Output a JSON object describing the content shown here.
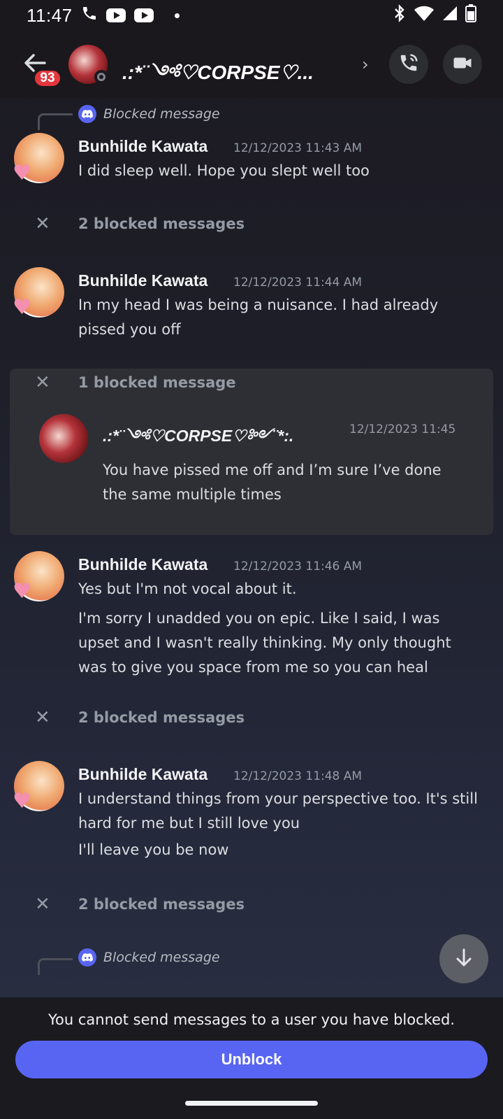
{
  "status_bar": {
    "time": "11:47"
  },
  "header": {
    "unread_badge": "93",
    "channel_name": ".:*¨༺♡CORPSE♡...",
    "chevron": "›"
  },
  "messages": [
    {
      "reply_to": "Blocked message",
      "author": "Bunhilde Kawata",
      "timestamp": "12/12/2023 11:43 AM",
      "lines": [
        "I did sleep well. Hope you slept well too"
      ]
    },
    {
      "blocked": "2 blocked messages"
    },
    {
      "author": "Bunhilde Kawata",
      "timestamp": "12/12/2023 11:44 AM",
      "lines": [
        "In my head I was being a nuisance. I had already pissed you off"
      ]
    },
    {
      "blocked": "1 blocked message",
      "expanded": {
        "author": ".:*¨༺♡CORPSE♡༻¨*:.",
        "timestamp": "12/12/2023 11:45",
        "text": "You have pissed me off and I’m sure I’ve done the same multiple times"
      }
    },
    {
      "author": "Bunhilde Kawata",
      "timestamp": "12/12/2023 11:46 AM",
      "lines": [
        "Yes but I'm not vocal about it.",
        "I'm sorry I unadded you on epic. Like I said, I was upset and I wasn't really thinking. My only thought was to give you space from me so you can heal"
      ]
    },
    {
      "blocked": "2 blocked messages"
    },
    {
      "author": "Bunhilde Kawata",
      "timestamp": "12/12/2023 11:48 AM",
      "lines": [
        "I understand things from your perspective too. It's still hard for me but I still love you",
        "I'll leave you be now"
      ]
    },
    {
      "blocked": "2 blocked messages"
    },
    {
      "reply_to": "Blocked message"
    }
  ],
  "footer": {
    "notice": "You cannot send messages to a user you have blocked.",
    "unblock_label": "Unblock"
  },
  "colors": {
    "accent": "#5865f2",
    "badge": "#e5363e",
    "header_bg": "#1a181d"
  },
  "icons": [
    "phone-icon",
    "youtube-icon",
    "bluetooth-icon",
    "wifi-icon",
    "signal-icon",
    "battery-icon",
    "back-arrow-icon",
    "voice-call-icon",
    "video-call-icon",
    "discord-icon",
    "close-icon",
    "arrow-down-icon"
  ]
}
